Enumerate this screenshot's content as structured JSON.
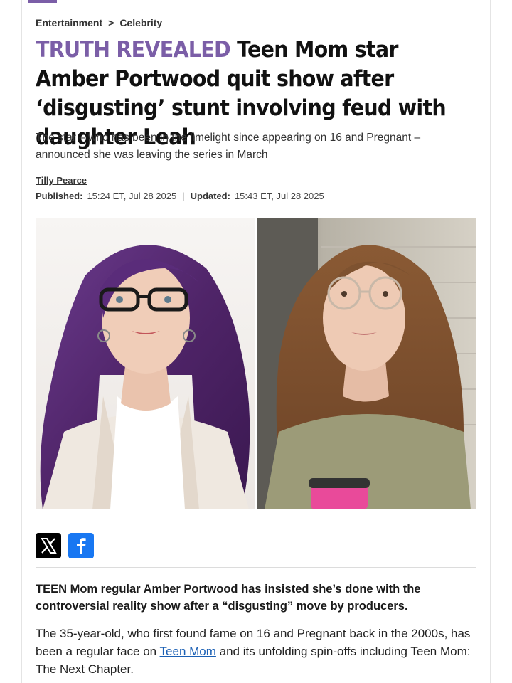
{
  "breadcrumb": {
    "section": "Entertainment",
    "separator": ">",
    "subsection": "Celebrity"
  },
  "article": {
    "kicker": "TRUTH REVEALED",
    "headline": "Teen Mom star Amber Portwood quit show after ‘disgusting’ stunt involving feud with daughter Leah",
    "standfirst": "The star – who has been in the limelight since appearing on 16 and Pregnant –  announced she was leaving the series in March",
    "author": "Tilly Pearce",
    "published_label": "Published:",
    "published_value": "15:24 ET, Jul 28 2025",
    "date_separator": "|",
    "updated_label": "Updated:",
    "updated_value": "15:43 ET, Jul 28 2025",
    "lead": "TEEN Mom regular Amber Portwood has insisted she’s done with the controversial reality show after a “disgusting” move by producers.",
    "body_before_link": "The 35-year-old, who first found fame on 16 and Pregnant back in the 2000s, has been a regular face on ",
    "body_link": "Teen Mom",
    "body_after_link": " and its unfolding spin-offs including Teen Mom: The Next Chapter."
  },
  "share": {
    "x_icon": "x-logo-icon",
    "facebook_icon": "facebook-logo-icon"
  },
  "colors": {
    "kicker": "#7b5ea7",
    "link": "#1a5fb4",
    "facebook": "#1877f2"
  }
}
